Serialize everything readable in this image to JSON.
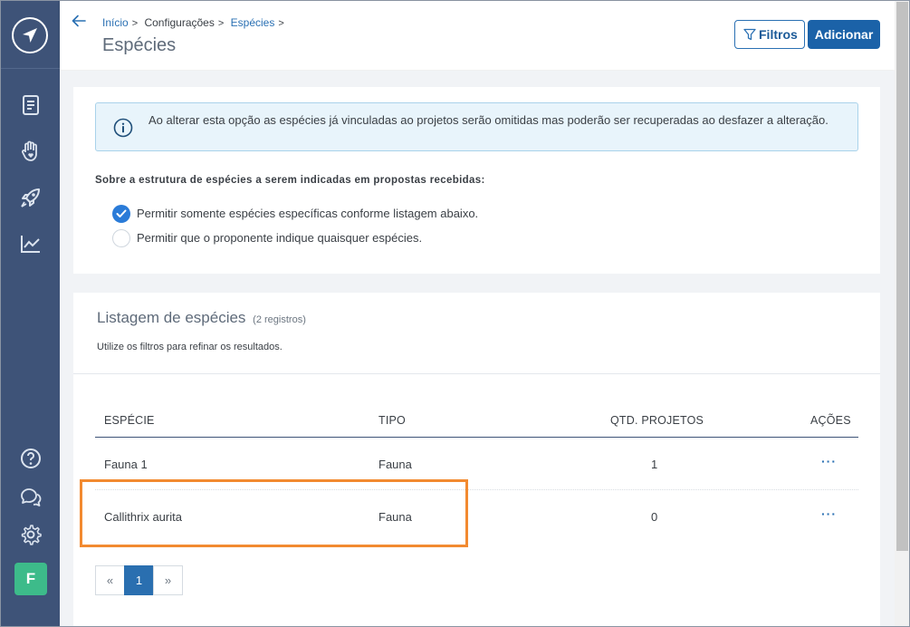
{
  "header": {
    "breadcrumb": [
      {
        "label": "Início",
        "link": true
      },
      {
        "label": "Configurações",
        "link": false
      },
      {
        "label": "Espécies",
        "link": true
      }
    ],
    "title": "Espécies",
    "filtros_label": "Filtros",
    "adicionar_label": "Adicionar"
  },
  "sidebar": {
    "items": [
      {
        "icon": "document-icon"
      },
      {
        "icon": "hand-heart-icon"
      },
      {
        "icon": "rocket-icon"
      },
      {
        "icon": "chart-line-icon"
      }
    ],
    "bottom_items": [
      {
        "icon": "help-icon"
      },
      {
        "icon": "chat-icon"
      },
      {
        "icon": "gear-icon"
      }
    ],
    "avatar_letter": "F"
  },
  "settings": {
    "alert_text": "Ao alterar esta opção as espécies já vinculadas ao projetos serão omitidas mas poderão ser recuperadas ao desfazer a alteração.",
    "question": "Sobre a estrutura de espécies a serem indicadas em propostas recebidas:",
    "options": [
      {
        "label": "Permitir somente espécies específicas conforme listagem abaixo.",
        "checked": true
      },
      {
        "label": "Permitir que o proponente indique quaisquer espécies.",
        "checked": false
      }
    ]
  },
  "listing": {
    "title": "Listagem de espécies",
    "count": "(2 registros)",
    "subtitle": "Utilize os filtros para refinar os resultados.",
    "columns": [
      "ESPÉCIE",
      "TIPO",
      "QTD. PROJETOS",
      "AÇÕES"
    ],
    "rows": [
      {
        "especie": "Fauna 1",
        "tipo": "Fauna",
        "qtd": "1",
        "acoes": "···"
      },
      {
        "especie": "Callithrix aurita",
        "tipo": "Fauna",
        "qtd": "0",
        "acoes": "···"
      }
    ]
  },
  "pagination": {
    "prev": "«",
    "current": "1",
    "next": "»"
  },
  "colors": {
    "sidebar": "#3e5378",
    "primary": "#1b62a8",
    "highlight": "#f28a30",
    "avatar": "#3dbb8a"
  }
}
